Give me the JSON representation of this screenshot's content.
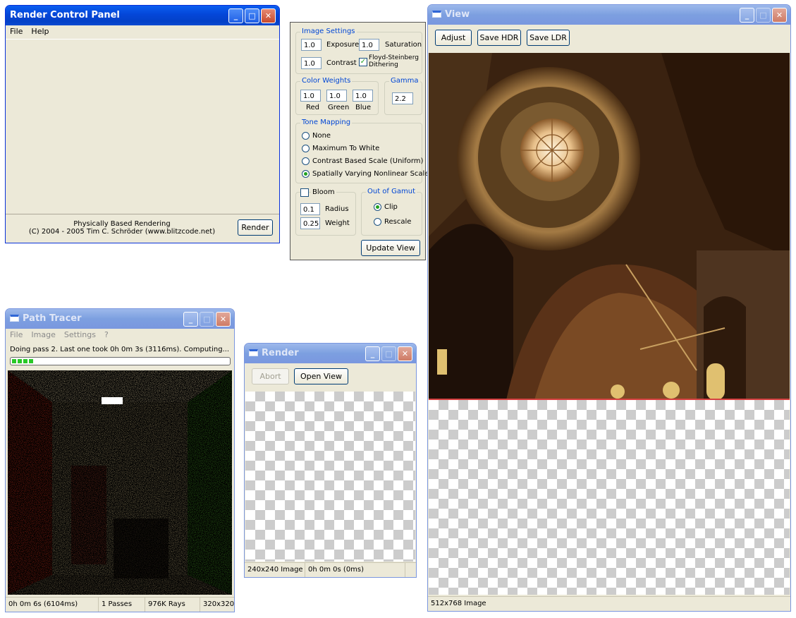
{
  "control_panel": {
    "title": "Render Control Panel",
    "menu": [
      "File",
      "Help"
    ],
    "footer_line1": "Physically Based Rendering",
    "footer_line2": "(C) 2004 - 2005 Tim C. Schröder (www.blitzcode.net)",
    "render_label": "Render"
  },
  "settings": {
    "image_settings": {
      "title": "Image Settings",
      "exposure_value": "1.0",
      "exposure_label": "Exposure",
      "saturation_value": "1.0",
      "saturation_label": "Saturation",
      "contrast_value": "1.0",
      "contrast_label": "Contrast",
      "dither_label_line1": "Floyd-Steinberg",
      "dither_label_line2": "Dithering",
      "dither_checked": true
    },
    "color_weights": {
      "title": "Color Weights",
      "red_value": "1.0",
      "green_value": "1.0",
      "blue_value": "1.0",
      "red_label": "Red",
      "green_label": "Green",
      "blue_label": "Blue"
    },
    "gamma": {
      "title": "Gamma",
      "value": "2.2"
    },
    "tone_mapping": {
      "title": "Tone Mapping",
      "options": [
        "None",
        "Maximum To White",
        "Contrast Based Scale (Uniform)",
        "Spatially Varying Nonlinear Scale"
      ],
      "selected": 3
    },
    "bloom": {
      "label": "Bloom",
      "checked": false,
      "radius_value": "0.1",
      "radius_label": "Radius",
      "weight_value": "0.25",
      "weight_label": "Weight"
    },
    "gamut": {
      "title": "Out of Gamut",
      "options": [
        "Clip",
        "Rescale"
      ],
      "selected": 0
    },
    "update_label": "Update View"
  },
  "path_tracer": {
    "title": "Path Tracer",
    "menu": [
      "File",
      "Image",
      "Settings",
      "?"
    ],
    "status_text": "Doing pass 2. Last one took 0h 0m 3s (3116ms). Computing...",
    "progress": 0.1,
    "statusbar": [
      "0h 0m 6s (6104ms)",
      "1 Passes",
      "976K Rays",
      "320x320"
    ]
  },
  "render_window": {
    "title": "Render",
    "abort_label": "Abort",
    "open_view_label": "Open View",
    "statusbar": [
      "240x240 Image",
      "0h 0m 0s (0ms)"
    ]
  },
  "view_window": {
    "title": "View",
    "adjust_label": "Adjust",
    "save_hdr_label": "Save HDR",
    "save_ldr_label": "Save LDR",
    "statusbar": [
      "512x768 Image"
    ]
  },
  "colors": {
    "title_active": "#0446d8",
    "window_bg": "#ece9d8",
    "group_title": "#0046d5",
    "progress_green": "#28c828"
  }
}
